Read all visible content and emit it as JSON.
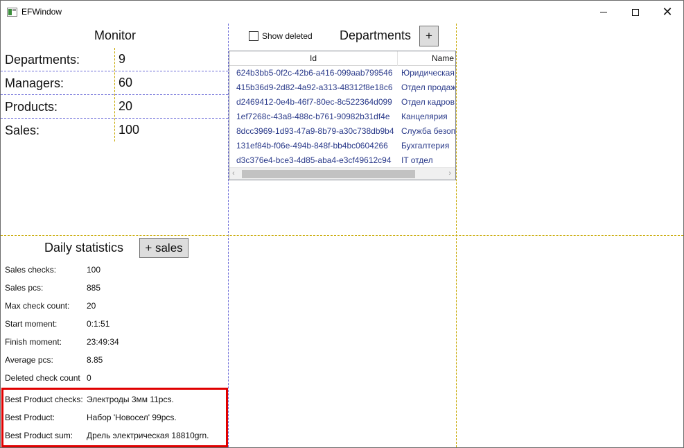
{
  "window": {
    "title": "EFWindow",
    "controls": {
      "minimize": "minimize",
      "maximize": "maximize",
      "close": "✕"
    }
  },
  "monitor": {
    "title": "Monitor",
    "rows": [
      {
        "label": "Departments:",
        "value": "9"
      },
      {
        "label": "Managers:",
        "value": "60"
      },
      {
        "label": "Products:",
        "value": "20"
      },
      {
        "label": "Sales:",
        "value": "100"
      }
    ]
  },
  "departments": {
    "show_deleted_label": "Show deleted",
    "show_deleted_checked": false,
    "title": "Departments",
    "add_button": "+",
    "columns": [
      "Id",
      "Name"
    ],
    "rows": [
      {
        "id": "624b3bb5-0f2c-42b6-a416-099aab799546",
        "name": "Юридическая"
      },
      {
        "id": "415b36d9-2d82-4a92-a313-48312f8e18c6",
        "name": "Отдел продаж"
      },
      {
        "id": "d2469412-0e4b-46f7-80ec-8c522364d099",
        "name": "Отдел кадров"
      },
      {
        "id": "1ef7268c-43a8-488c-b761-90982b31df4e",
        "name": "Канцелярия"
      },
      {
        "id": "8dcc3969-1d93-47a9-8b79-a30c738db9b4",
        "name": "Служба безоп"
      },
      {
        "id": "131ef84b-f06e-494b-848f-bb4bc0604266",
        "name": "Бухгалтерия"
      },
      {
        "id": "d3c376e4-bce3-4d85-aba4-e3cf49612c94",
        "name": "IT отдел"
      }
    ],
    "scroll_left": "‹",
    "scroll_right": "›"
  },
  "daily": {
    "title": "Daily statistics",
    "add_sales_button": "+ sales",
    "stats": [
      {
        "label": "Sales checks:",
        "value": "100"
      },
      {
        "label": "Sales pcs:",
        "value": "885"
      },
      {
        "label": "Max check count:",
        "value": "20"
      },
      {
        "label": "Start moment:",
        "value": "0:1:51"
      },
      {
        "label": "Finish moment:",
        "value": "23:49:34"
      },
      {
        "label": "Average pcs:",
        "value": "8.85"
      },
      {
        "label": "Deleted check count",
        "value": "0"
      },
      {
        "label": "Best Product checks:",
        "value": "Электроды 3мм 11pcs."
      },
      {
        "label": "Best Product:",
        "value": "Набор 'Новосел' 99pcs."
      },
      {
        "label": "Best Product sum:",
        "value": "Дрель электрическая 18810grn."
      }
    ]
  },
  "colors": {
    "grid_line_blue": "#6b6bd8",
    "grid_line_yellow": "#c7a800",
    "highlight": "#e00000",
    "row_text": "#2a3a8a"
  }
}
